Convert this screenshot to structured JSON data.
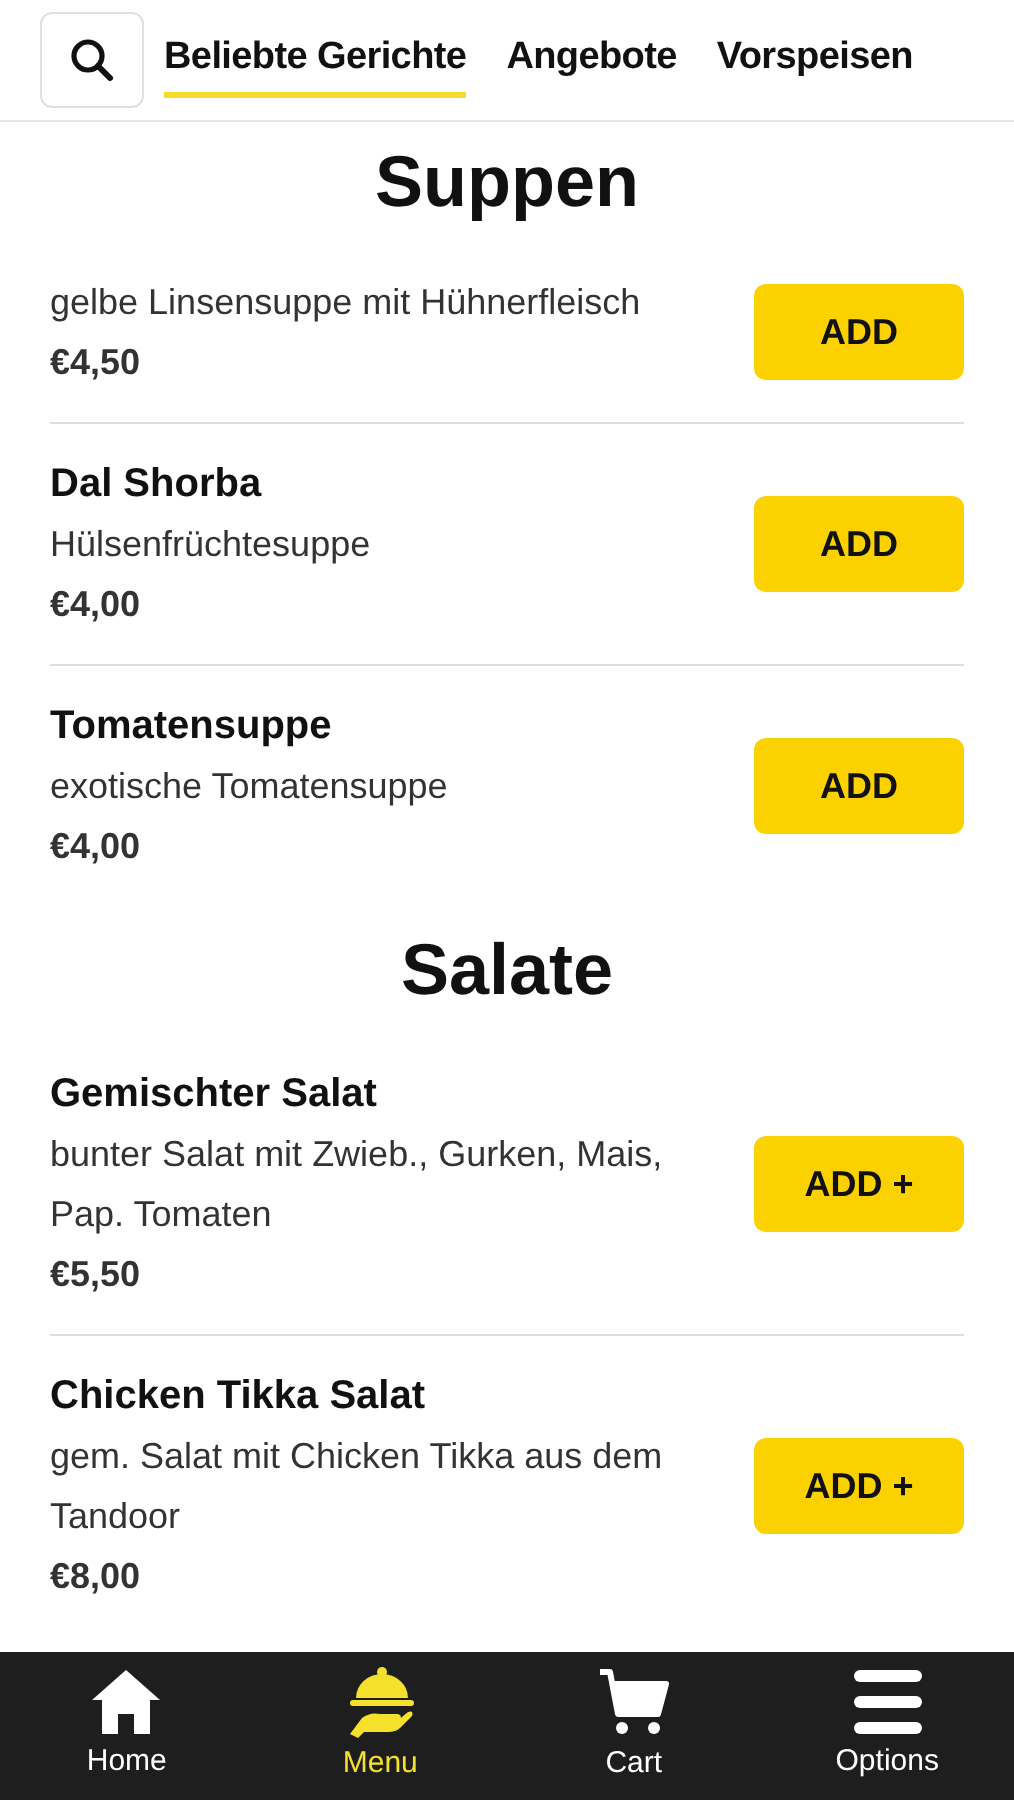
{
  "tabs": [
    {
      "label": "Beliebte Gerichte",
      "selected": true
    },
    {
      "label": "Angebote",
      "selected": false
    },
    {
      "label": "Vorspeisen",
      "selected": false
    }
  ],
  "sections": [
    {
      "title": "Suppen",
      "items": [
        {
          "description": "gelbe Linsensuppe mit Hühnerfleisch",
          "price": "€4,50",
          "button": "ADD"
        },
        {
          "name": "Dal Shorba",
          "description": "Hülsenfrüchtesuppe",
          "price": "€4,00",
          "button": "ADD"
        },
        {
          "name": "Tomatensuppe",
          "description": "exotische Tomatensuppe",
          "price": "€4,00",
          "button": "ADD"
        }
      ]
    },
    {
      "title": "Salate",
      "items": [
        {
          "name": "Gemischter Salat",
          "description": "bunter Salat mit Zwieb., Gurken, Mais, Pap. Tomaten",
          "price": "€5,50",
          "button": "ADD +"
        },
        {
          "name": "Chicken Tikka Salat",
          "description": "gem. Salat mit Chicken Tikka aus dem Tandoor",
          "price": "€8,00",
          "button": "ADD +"
        }
      ]
    }
  ],
  "nav": [
    {
      "kind": "home",
      "label": "Home",
      "selected": false
    },
    {
      "kind": "menu",
      "label": "Menu",
      "selected": true
    },
    {
      "kind": "cart",
      "label": "Cart",
      "selected": false
    },
    {
      "kind": "options",
      "label": "Options",
      "selected": false
    }
  ]
}
